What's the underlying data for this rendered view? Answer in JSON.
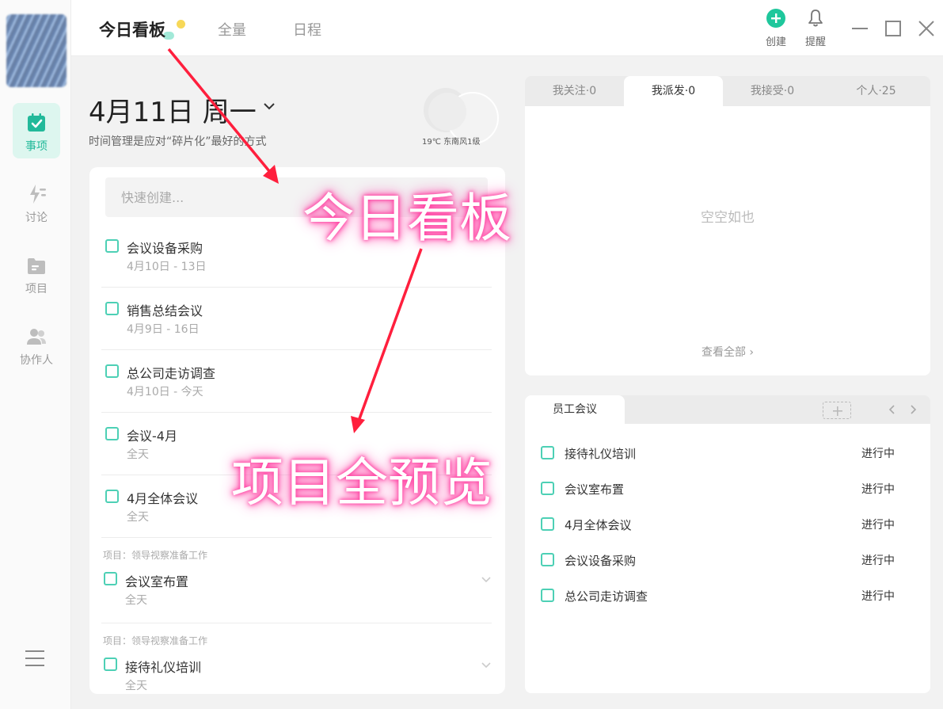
{
  "sidebar": {
    "items": [
      {
        "label": "事项",
        "icon": "calendar-check-icon",
        "active": true
      },
      {
        "label": "讨论",
        "icon": "lightning-icon",
        "active": false
      },
      {
        "label": "项目",
        "icon": "folder-icon",
        "active": false
      },
      {
        "label": "协作人",
        "icon": "people-icon",
        "active": false
      }
    ],
    "menu_icon": "hamburger-menu-icon"
  },
  "topbar": {
    "tabs": [
      {
        "label": "今日看板",
        "active": true
      },
      {
        "label": "全量",
        "active": false
      },
      {
        "label": "日程",
        "active": false
      }
    ],
    "create_label": "创建",
    "remind_label": "提醒"
  },
  "header": {
    "date": "4月11日 周一",
    "subtitle": "时间管理是应对“碎片化”最好的方式",
    "weather": "19℃ 东南风1级"
  },
  "quick_create": {
    "placeholder": "快速创建..."
  },
  "tasks": [
    {
      "project": "",
      "title": "会议设备采购",
      "date": "4月10日 - 13日"
    },
    {
      "project": "",
      "title": "销售总结会议",
      "date": "4月9日 - 16日"
    },
    {
      "project": "",
      "title": "总公司走访调查",
      "date": "4月10日 - 今天"
    },
    {
      "project": "",
      "title": "会议-4月",
      "date": "全天"
    },
    {
      "project": "",
      "title": "4月全体会议",
      "date": "全天"
    },
    {
      "project": "项目：领导视察准备工作",
      "title": "会议室布置",
      "date": "全天"
    },
    {
      "project": "项目：领导视察准备工作",
      "title": "接待礼仪培训",
      "date": "全天"
    }
  ],
  "right_panel": {
    "tabs": [
      {
        "label": "我关注·0",
        "active": false
      },
      {
        "label": "我派发·0",
        "active": true
      },
      {
        "label": "我接受·0",
        "active": false
      },
      {
        "label": "个人·25",
        "active": false
      }
    ],
    "empty_text": "空空如也",
    "view_all": "查看全部 ›"
  },
  "project_panel": {
    "tab": "员工会议",
    "rows": [
      {
        "name": "接待礼仪培训",
        "status": "进行中"
      },
      {
        "name": "会议室布置",
        "status": "进行中"
      },
      {
        "name": "4月全体会议",
        "status": "进行中"
      },
      {
        "name": "会议设备采购",
        "status": "进行中"
      },
      {
        "name": "总公司走访调查",
        "status": "进行中"
      }
    ]
  },
  "annotations": {
    "label_1": "今日看板",
    "label_2": "项目全预览",
    "color": "#ff1f3d"
  },
  "colors": {
    "accent": "#22b99a",
    "accent_light": "#ddf6ef",
    "checkbox": "#4dd0b5"
  }
}
